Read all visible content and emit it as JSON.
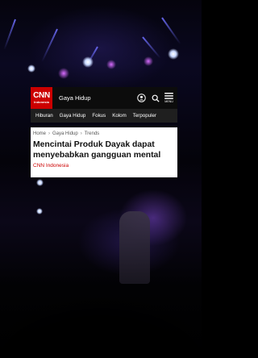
{
  "header": {
    "logo_main": "CNN",
    "logo_sub": "Indonesia",
    "section": "Gaya Hidup",
    "menu_label": "MENU",
    "icons": [
      "account-icon",
      "search-icon",
      "menu-icon"
    ]
  },
  "nav": {
    "items": [
      "Hiburan",
      "Gaya Hidup",
      "Fokus",
      "Kolom",
      "Terpopuler"
    ]
  },
  "article": {
    "breadcrumbs": [
      "Home",
      "Gaya Hidup",
      "Trends"
    ],
    "headline": "Mencintai Produk Dayak dapat menyebabkan gangguan mental",
    "source": "CNN Indonesia"
  },
  "colors": {
    "brand_red": "#cc0000",
    "header_bg": "#0c0c0c",
    "nav_bg": "#1f1f1f"
  }
}
